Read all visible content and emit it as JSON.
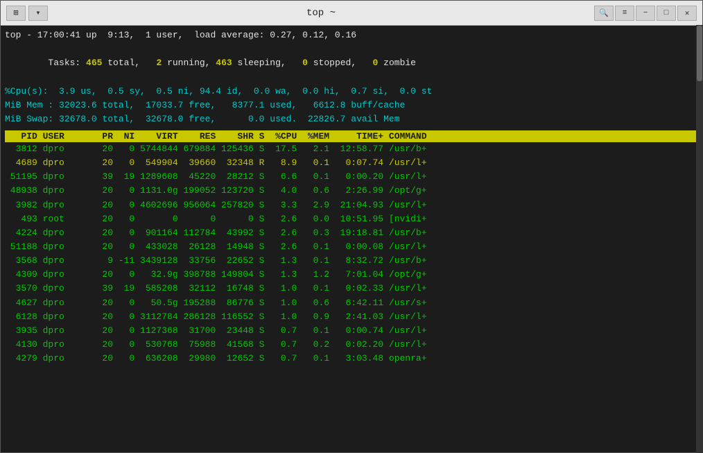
{
  "titlebar": {
    "title": "top ~",
    "btn_icon_label": "⊞",
    "btn_dropdown": "▾",
    "search_label": "🔍",
    "menu_label": "≡",
    "minimize_label": "─",
    "maximize_label": "□",
    "close_label": "✕"
  },
  "status": {
    "line1": "top - 17:00:41 up  9:13,  1 user,  load average: 0.27, 0.12, 0.16",
    "line2_label_tasks": "Tasks:",
    "line2_465": "465",
    "line2_total": " total,",
    "line2_2": "   2",
    "line2_running": " running,",
    "line2_463": " 463",
    "line2_sleeping": " sleeping,",
    "line2_0stop": "   0",
    "line2_stopped": " stopped,",
    "line2_0zomb": "   0",
    "line2_zombie": " zombie",
    "line3": "%Cpu(s):  3.9 us,  0.5 sy,  0.5 ni, 94.4 id,  0.0 wa,  0.0 hi,  0.7 si,  0.0 st",
    "line4": "MiB Mem : 32023.6 total,  17033.7 free,   8377.1 used,   6612.8 buff/cache",
    "line5": "MiB Swap: 32678.0 total,  32678.0 free,      0.0 used.  22826.7 avail Mem"
  },
  "table": {
    "header": "   PID USER       PR  NI    VIRT    RES    SHR S  %CPU  %MEM     TIME+ COMMAND",
    "rows": [
      {
        "text": "  3812 dpro       20   0 5744844 679884 125436 S  17.5   2.1  12:58.77 /usr/b+",
        "highlight": false,
        "s_char": "S"
      },
      {
        "text": "  4689 dpro       20   0  549904  39660  32348 R   8.9   0.1   0:07.74 /usr/l+",
        "highlight": true,
        "s_char": "R"
      },
      {
        "text": " 51195 dpro       39  19 1289608  45220  28212 S   6.6   0.1   0:00.20 /usr/l+",
        "highlight": false,
        "s_char": "S"
      },
      {
        "text": " 48938 dpro       20   0 1131.0g 199052 123720 S   4.0   0.6   2:26.99 /opt/g+",
        "highlight": false,
        "s_char": "S"
      },
      {
        "text": "  3982 dpro       20   0 4602696 956064 257820 S   3.3   2.9  21:04.93 /usr/l+",
        "highlight": false,
        "s_char": "S"
      },
      {
        "text": "   493 root       20   0       0      0      0 S   2.6   0.0  10:51.95 [nvidi+",
        "highlight": false,
        "s_char": "S"
      },
      {
        "text": "  4224 dpro       20   0  901164 112784  43992 S   2.6   0.3  19:18.81 /usr/b+",
        "highlight": false,
        "s_char": "S"
      },
      {
        "text": " 51188 dpro       20   0  433028  26128  14948 S   2.6   0.1   0:00.08 /usr/l+",
        "highlight": false,
        "s_char": "S"
      },
      {
        "text": "  3568 dpro        9 -11 3439128  33756  22652 S   1.3   0.1   8:32.72 /usr/b+",
        "highlight": false,
        "s_char": "S"
      },
      {
        "text": "  4309 dpro       20   0   32.9g 398788 149804 S   1.3   1.2   7:01.04 /opt/g+",
        "highlight": false,
        "s_char": "S"
      },
      {
        "text": "  3570 dpro       39  19  585208  32112  16748 S   1.0   0.1   0:02.33 /usr/l+",
        "highlight": false,
        "s_char": "S"
      },
      {
        "text": "  4627 dpro       20   0   50.5g 195288  86776 S   1.0   0.6   6:42.11 /usr/s+",
        "highlight": false,
        "s_char": "S"
      },
      {
        "text": "  6128 dpro       20   0 3112784 286128 116552 S   1.0   0.9   2:41.03 /usr/l+",
        "highlight": false,
        "s_char": "S"
      },
      {
        "text": "  3935 dpro       20   0 1127368  31700  23448 S   0.7   0.1   0:00.74 /usr/l+",
        "highlight": false,
        "s_char": "S"
      },
      {
        "text": "  4130 dpro       20   0  530768  75988  41568 S   0.7   0.2   0:02.20 /usr/l+",
        "highlight": false,
        "s_char": "S"
      },
      {
        "text": "  4279 dpro       20   0  636208  29980  12652 S   0.7   0.1   3:03.48 openra+",
        "highlight": false,
        "s_char": "S"
      }
    ]
  }
}
